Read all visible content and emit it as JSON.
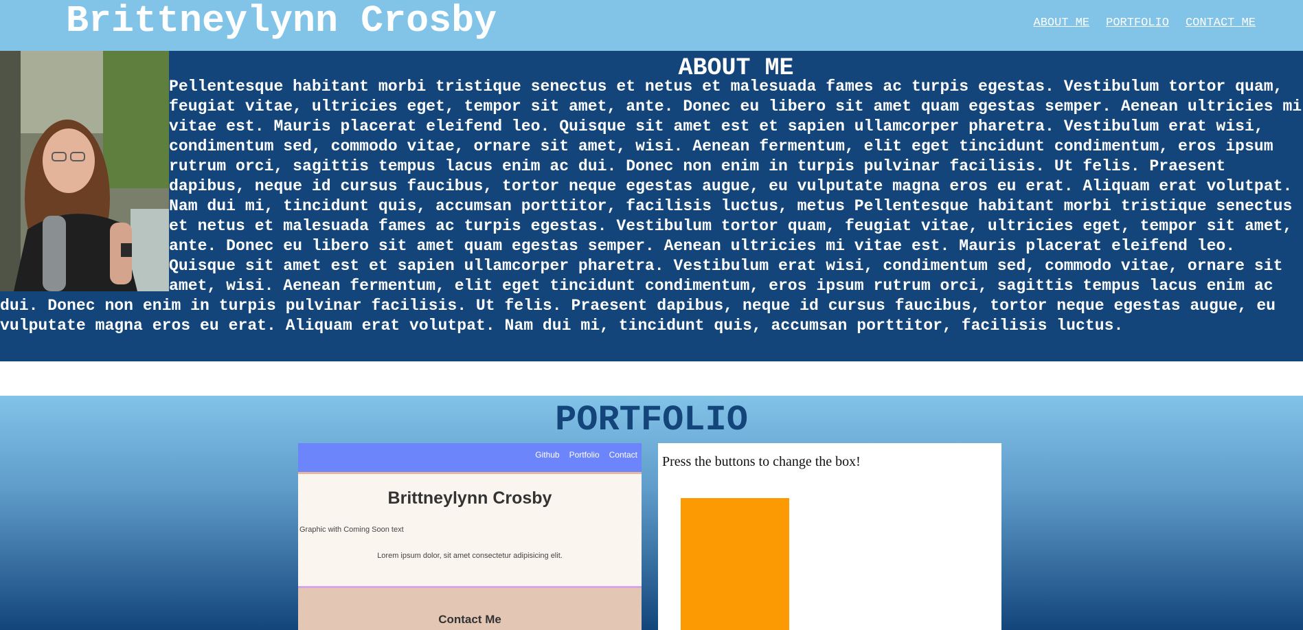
{
  "header": {
    "title": "Brittneylynn Crosby",
    "nav": [
      "ABOUT ME",
      "PORTFOLIO",
      "CONTACT ME"
    ]
  },
  "about": {
    "heading": "ABOUT ME",
    "body": "Pellentesque habitant morbi tristique senectus et netus et malesuada fames ac turpis egestas. Vestibulum tortor quam, feugiat vitae, ultricies eget, tempor sit amet, ante. Donec eu libero sit amet quam egestas semper. Aenean ultricies mi vitae est. Mauris placerat eleifend leo. Quisque sit amet est et sapien ullamcorper pharetra. Vestibulum erat wisi, condimentum sed, commodo vitae, ornare sit amet, wisi. Aenean fermentum, elit eget tincidunt condimentum, eros ipsum rutrum orci, sagittis tempus lacus enim ac dui. Donec non enim in turpis pulvinar facilisis. Ut felis. Praesent dapibus, neque id cursus faucibus, tortor neque egestas augue, eu vulputate magna eros eu erat. Aliquam erat volutpat. Nam dui mi, tincidunt quis, accumsan porttitor, facilisis luctus, metus Pellentesque habitant morbi tristique senectus et netus et malesuada fames ac turpis egestas. Vestibulum tortor quam, feugiat vitae, ultricies eget, tempor sit amet, ante. Donec eu libero sit amet quam egestas semper. Aenean ultricies mi vitae est. Mauris placerat eleifend leo. Quisque sit amet est et sapien ullamcorper pharetra. Vestibulum erat wisi, condimentum sed, commodo vitae, ornare sit amet, wisi. Aenean fermentum, elit eget tincidunt condimentum, eros ipsum rutrum orci, sagittis tempus lacus enim ac dui. Donec non enim in turpis pulvinar facilisis. Ut felis. Praesent dapibus, neque id cursus faucibus, tortor neque egestas augue, eu vulputate magna eros eu erat. Aliquam erat volutpat. Nam dui mi, tincidunt quis, accumsan porttitor, facilisis luctus."
  },
  "portfolio": {
    "heading": "PORTFOLIO",
    "card1": {
      "nav": [
        "Github",
        "Portfolio",
        "Contact"
      ],
      "title": "Brittneylynn Crosby",
      "graphic_text": "Graphic with Coming Soon text",
      "lorem": "Lorem ipsum dolor, sit amet consectetur adipisicing elit.",
      "contact_label": "Contact Me"
    },
    "card2": {
      "text": "Press the buttons to change the box!",
      "box_color": "#fc9a03"
    }
  },
  "colors": {
    "header_bg": "#82c3e8",
    "about_bg": "#13457b",
    "portfolio_heading": "#13457b"
  }
}
